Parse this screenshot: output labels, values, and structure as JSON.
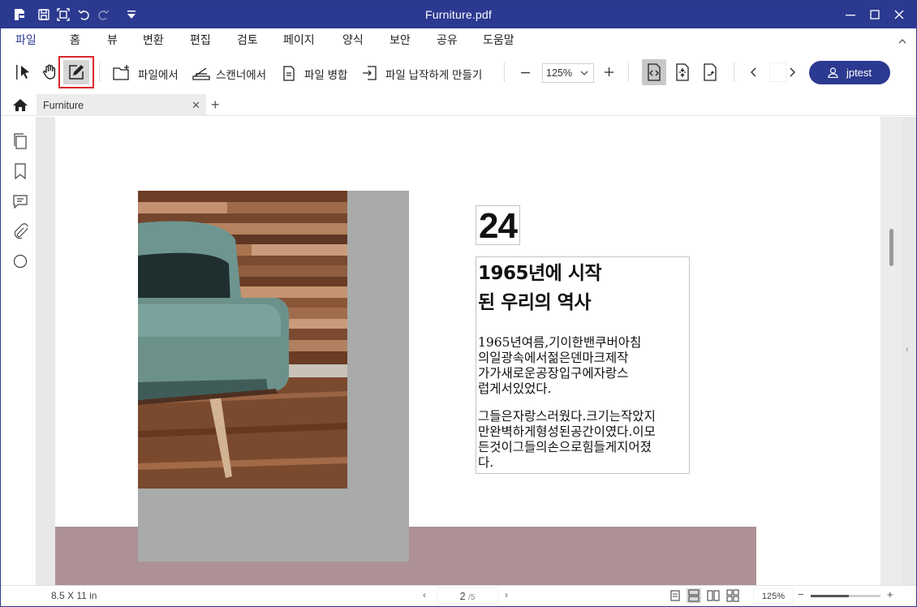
{
  "window": {
    "title": "Furniture.pdf"
  },
  "menu": {
    "items": [
      "파일",
      "홈",
      "뷰",
      "변환",
      "편집",
      "검토",
      "페이지",
      "양식",
      "보안",
      "공유",
      "도움말"
    ],
    "active": "홈"
  },
  "toolbar": {
    "from_file": "파일에서",
    "from_scanner": "스캔너에서",
    "merge_files": "파일 병합",
    "flatten_file": "파일 납작하게 만들기",
    "zoom": "125%",
    "user": "jptest"
  },
  "tabs": {
    "document": "Furniture"
  },
  "document": {
    "number": "24",
    "heading_lines": [
      "1965년에 시작",
      "된 우리의 역사"
    ],
    "para1_lines": [
      "1965년여름,기이한밴쿠버아침",
      "의일광속에서젊은덴마크제작",
      "가가새로운공장입구에자랑스",
      "럽게서있었다."
    ],
    "para2_lines": [
      "그들은자랑스러웠다.크기는작았지",
      "만완벽하게형성된공간이였다.이모",
      "든것이그들의손으로힘들게지어졌",
      "다."
    ]
  },
  "status": {
    "page_size": "8.5 X 11 in",
    "current_page": "2",
    "total_pages": "/5",
    "zoom": "125%",
    "zoom_level": 0.55
  },
  "colors": {
    "brand": "#2b3990",
    "highlight": "#d9262c",
    "mauve": "#ad9196",
    "grey_block": "#a9abaa"
  }
}
